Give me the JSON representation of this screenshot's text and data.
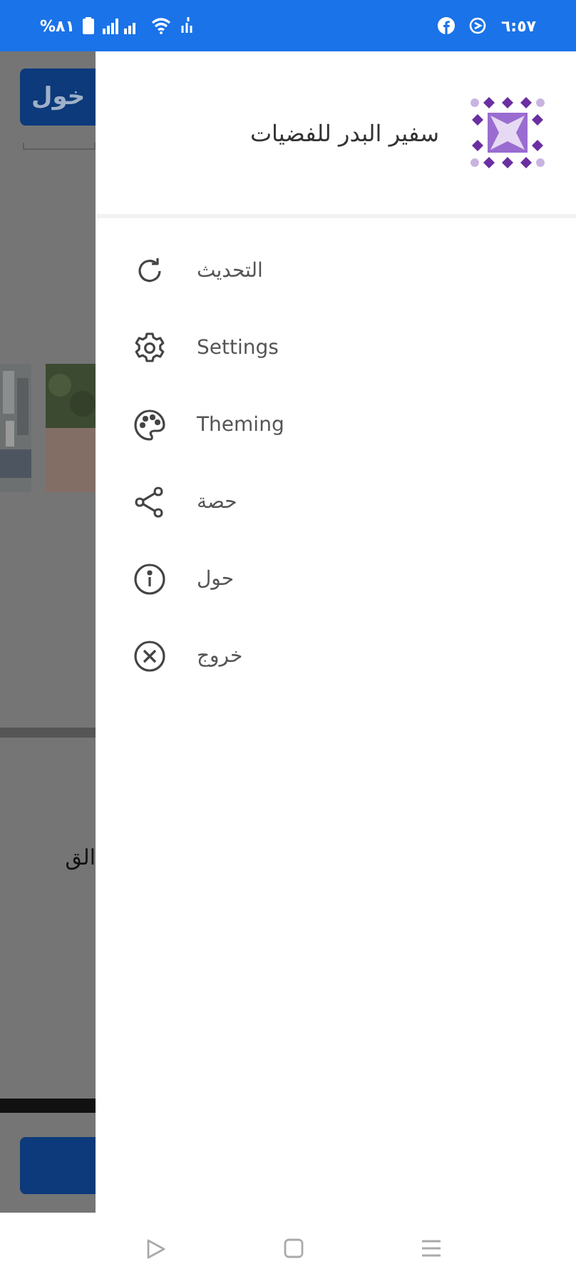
{
  "status_bar": {
    "time": "٦:٥٧",
    "battery": "%٨١"
  },
  "background": {
    "login_button": "خول",
    "text": "الق"
  },
  "drawer": {
    "title": "سفير البدر للفضيات",
    "items": [
      {
        "kind": "refresh",
        "label": "التحديث"
      },
      {
        "kind": "settings",
        "label": "Settings"
      },
      {
        "kind": "palette",
        "label": "Theming"
      },
      {
        "kind": "share",
        "label": "حصة"
      },
      {
        "kind": "info",
        "label": "حول"
      },
      {
        "kind": "exit",
        "label": "خروج"
      }
    ]
  }
}
